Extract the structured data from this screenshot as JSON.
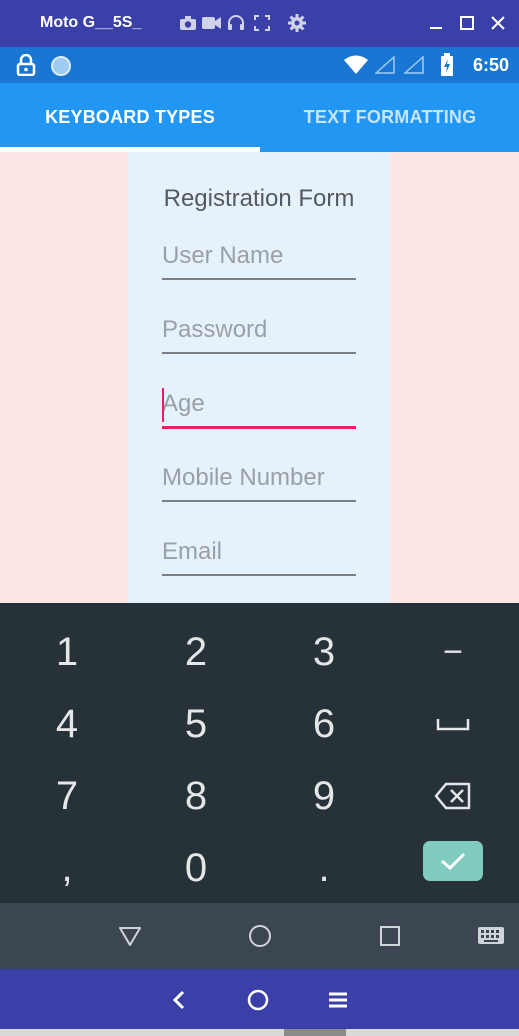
{
  "emulator": {
    "device_title": "Moto G__5S_"
  },
  "status_bar": {
    "time": "6:50"
  },
  "tabs": [
    {
      "label": "KEYBOARD TYPES"
    },
    {
      "label": "TEXT FORMATTING"
    }
  ],
  "form": {
    "title": "Registration Form",
    "fields": [
      {
        "placeholder": "User Name"
      },
      {
        "placeholder": "Password"
      },
      {
        "placeholder": "Age"
      },
      {
        "placeholder": "Mobile Number"
      },
      {
        "placeholder": "Email"
      }
    ]
  },
  "keyboard": {
    "row1": [
      "1",
      "2",
      "3",
      "−"
    ],
    "row2": [
      "4",
      "5",
      "6"
    ],
    "row3": [
      "7",
      "8",
      "9"
    ],
    "row4": [
      ",",
      "0",
      "."
    ]
  },
  "colors": {
    "title_bar": "#3b3fa8",
    "status_bar": "#1976d2",
    "tab_bar": "#2196f3",
    "content_bg": "#fde6e3",
    "form_bg": "#e6f2fb",
    "focus_accent": "#e91e63",
    "keyboard_bg": "#263238",
    "enter_key": "#7fcbbf"
  }
}
